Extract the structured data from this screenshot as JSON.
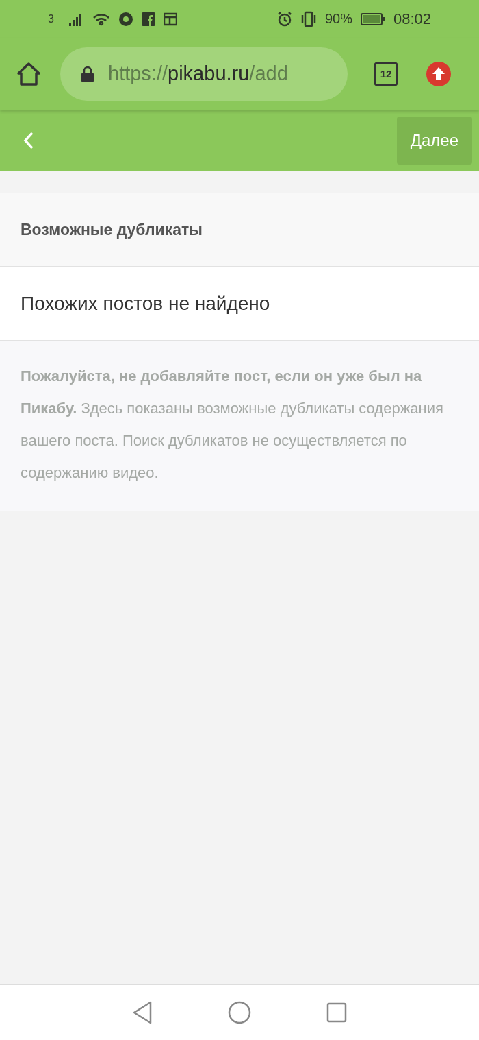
{
  "status_bar": {
    "sim": "3",
    "battery": "90%",
    "time": "08:02"
  },
  "browser": {
    "url_scheme": "https://",
    "url_host": "pikabu.ru",
    "url_path": "/add",
    "tab_count": "12"
  },
  "header": {
    "next_button": "Далее"
  },
  "duplicates": {
    "title": "Возможные дубликаты",
    "result": "Похожих постов не найдено",
    "notice": "**Пожалуйста, не добавляйте пост, если он уже был на Пикабу.** Здесь показаны возможные дубликаты содержания вашего поста. Поиск дубликатов не осуществляется по содержанию видео."
  }
}
